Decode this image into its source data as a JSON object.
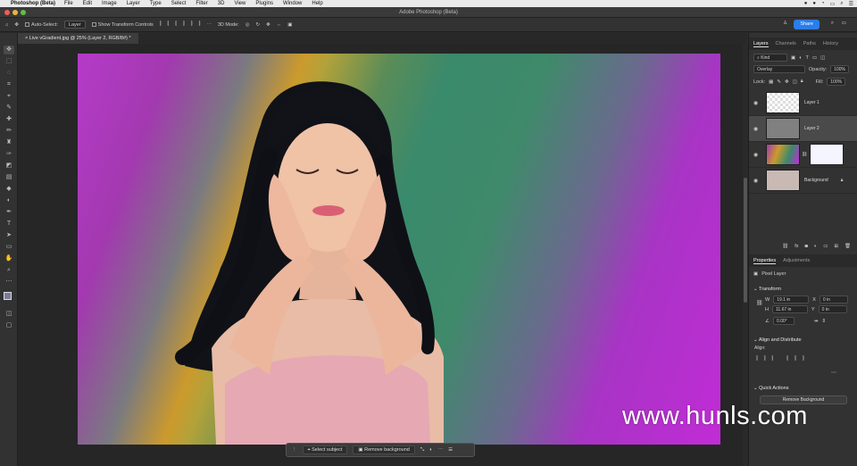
{
  "menubar": {
    "app_name": "Photoshop (Beta)",
    "items": [
      "File",
      "Edit",
      "Image",
      "Layer",
      "Type",
      "Select",
      "Filter",
      "3D",
      "View",
      "Plugins",
      "Window",
      "Help"
    ]
  },
  "window": {
    "title": "Adobe Photoshop (Beta)"
  },
  "options_bar": {
    "auto_select_label": "Auto-Select:",
    "auto_select_value": "Layer",
    "transform_label": "Show Transform Controls",
    "mode_label": "3D Mode:",
    "share_label": "Share"
  },
  "document": {
    "tab_title": "Live vGradient.jpg @ 25% (Layer 2, RGB/8#) *"
  },
  "contextual_bar": {
    "select_subject": "Select subject",
    "remove_background": "Remove background"
  },
  "layers_panel": {
    "tabs": [
      "Layers",
      "Channels",
      "Paths",
      "History"
    ],
    "filter_label": "Kind",
    "blend_mode": "Overlay",
    "opacity_label": "Opacity:",
    "opacity_value": "100%",
    "lock_label": "Lock:",
    "fill_label": "Fill:",
    "fill_value": "100%",
    "layers": [
      {
        "name": "Layer 1"
      },
      {
        "name": "Layer 2"
      },
      {
        "name": ""
      },
      {
        "name": "Background"
      }
    ]
  },
  "properties_panel": {
    "tabs": [
      "Properties",
      "Adjustments"
    ],
    "layer_type": "Pixel Layer",
    "transform_title": "Transform",
    "w_label": "W",
    "w_value": "19.1 in",
    "x_label": "X",
    "x_value": "0 in",
    "h_label": "H",
    "h_value": "11.67 in",
    "y_label": "Y",
    "y_value": "0 in",
    "angle_value": "0.00°",
    "align_title": "Align and Distribute",
    "align_label": "Align:",
    "quick_actions_title": "Quick Actions",
    "remove_background": "Remove Background"
  },
  "watermark": {
    "text": "www.hunls.com"
  },
  "colors": {
    "accent": "#2b7de9",
    "panel": "#323232",
    "canvas_bg": "#262626"
  }
}
